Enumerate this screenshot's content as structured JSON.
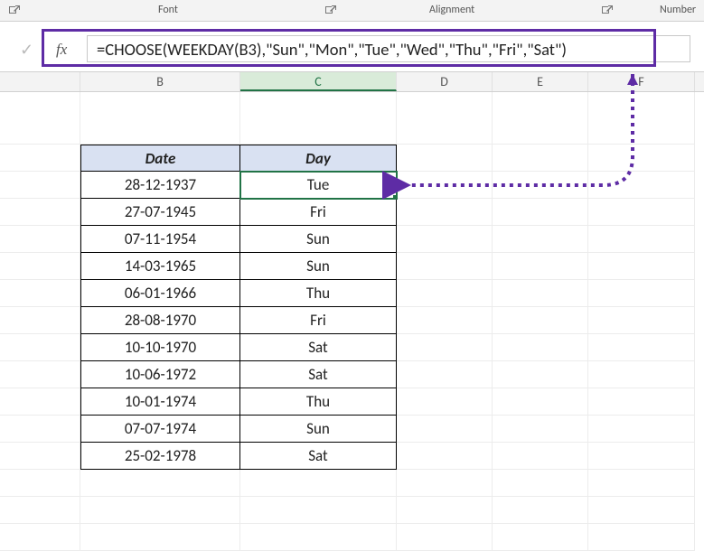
{
  "ribbon": {
    "font_label": "Font",
    "alignment_label": "Alignment",
    "number_label": "Number"
  },
  "formula_bar": {
    "fx": "fx",
    "formula": "=CHOOSE(WEEKDAY(B3),\"Sun\",\"Mon\",\"Tue\",\"Wed\",\"Thu\",\"Fri\",\"Sat\")"
  },
  "columns": {
    "B": "B",
    "C": "C",
    "D": "D",
    "E": "E",
    "F": "F"
  },
  "table": {
    "header_date": "Date",
    "header_day": "Day",
    "rows": [
      {
        "date": "28-12-1937",
        "day": "Tue"
      },
      {
        "date": "27-07-1945",
        "day": "Fri"
      },
      {
        "date": "07-11-1954",
        "day": "Sun"
      },
      {
        "date": "14-03-1965",
        "day": "Sun"
      },
      {
        "date": "06-01-1966",
        "day": "Thu"
      },
      {
        "date": "28-08-1970",
        "day": "Fri"
      },
      {
        "date": "10-10-1970",
        "day": "Sat"
      },
      {
        "date": "10-06-1972",
        "day": "Sat"
      },
      {
        "date": "10-01-1974",
        "day": "Thu"
      },
      {
        "date": "07-07-1974",
        "day": "Sun"
      },
      {
        "date": "25-02-1978",
        "day": "Sat"
      }
    ]
  }
}
